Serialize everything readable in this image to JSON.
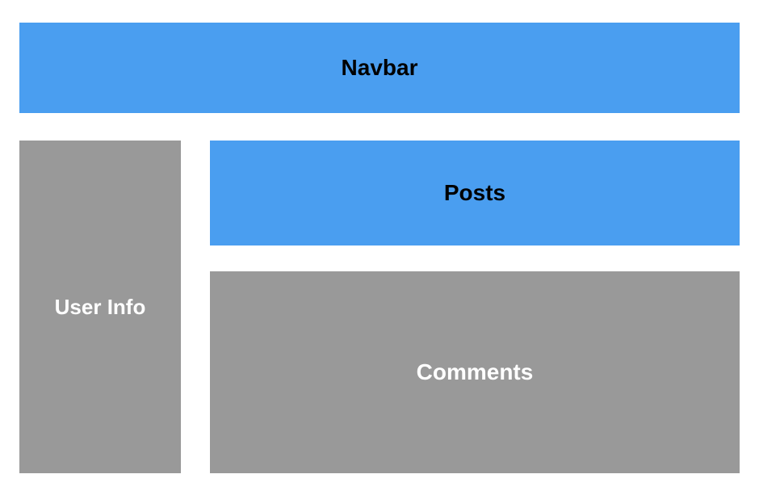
{
  "layout": {
    "navbar": {
      "label": "Navbar"
    },
    "sidebar": {
      "label": "User Info"
    },
    "main": {
      "posts": {
        "label": "Posts"
      },
      "comments": {
        "label": "Comments"
      }
    }
  },
  "colors": {
    "primary": "#4A9EF0",
    "secondary": "#999999",
    "text_dark": "#000000",
    "text_light": "#ffffff"
  }
}
